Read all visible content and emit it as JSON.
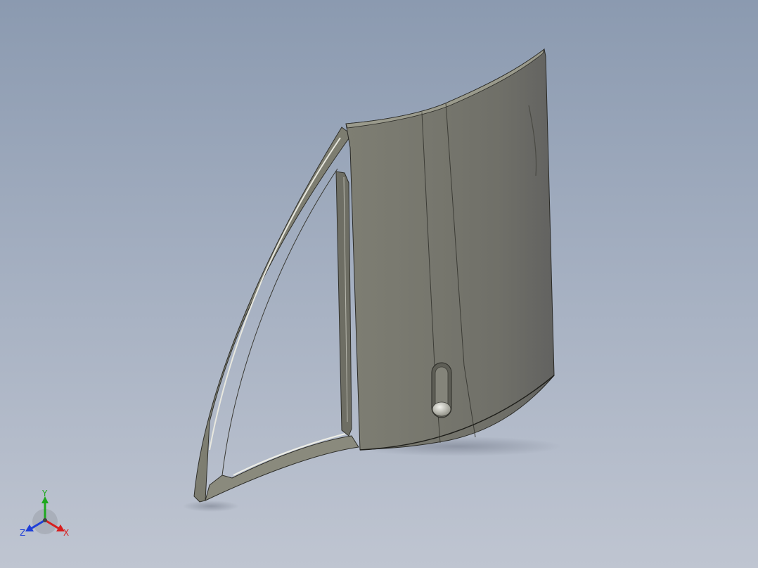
{
  "viewport": {
    "background_top": "#8b9ab0",
    "background_bottom": "#bfc5d1",
    "model_color": "#7a7a6e",
    "model_shadow_color": "#5e5e55"
  },
  "triad": {
    "x_label": "X",
    "y_label": "Y",
    "z_label": "Z",
    "x_color": "#d81e1e",
    "y_color": "#1ea81e",
    "z_color": "#1e3ed8"
  }
}
